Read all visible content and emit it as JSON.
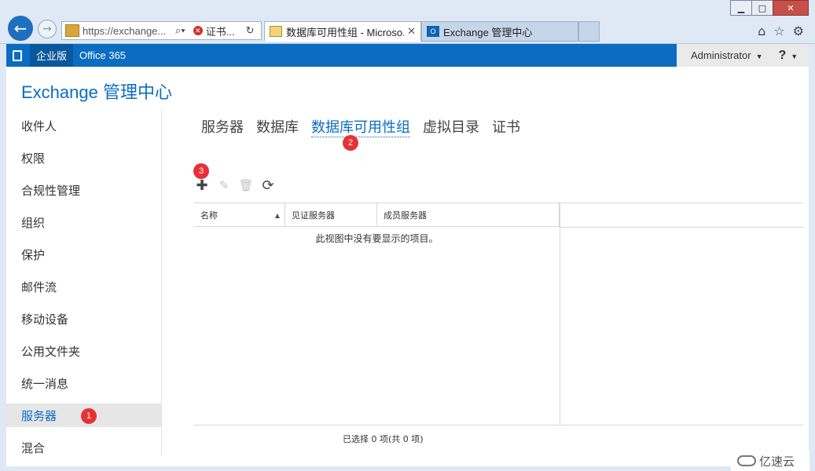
{
  "browser": {
    "address": "https://exchange...",
    "cert_label": "证书...",
    "tabs": [
      {
        "label": "数据库可用性组 - Microso...",
        "close": "✕"
      },
      {
        "label": "Exchange 管理中心"
      }
    ]
  },
  "topbar": {
    "items": [
      "企业版",
      "Office 365"
    ],
    "user": "Administrator",
    "help": "?"
  },
  "app": {
    "title": "Exchange 管理中心"
  },
  "leftnav": {
    "items": [
      "收件人",
      "权限",
      "合规性管理",
      "组织",
      "保护",
      "邮件流",
      "移动设备",
      "公用文件夹",
      "统一消息",
      "服务器",
      "混合"
    ],
    "selected_index": 9
  },
  "subnav": {
    "items": [
      "服务器",
      "数据库",
      "数据库可用性组",
      "虚拟目录",
      "证书"
    ],
    "active_index": 2
  },
  "badges": [
    "1",
    "2",
    "3"
  ],
  "toolbar": {
    "icons": [
      "add-icon",
      "edit-icon",
      "delete-icon",
      "refresh-icon"
    ]
  },
  "grid": {
    "columns": [
      "名称",
      "见证服务器",
      "成员服务器"
    ],
    "sorted_column": "名称",
    "empty_message": "此视图中没有要显示的项目。"
  },
  "status": {
    "text": "已选择 0 项(共 0 项)"
  },
  "watermark": {
    "text": "亿速云"
  },
  "colors": {
    "accent": "#0a6dc2",
    "badge": "#e63237",
    "selected_bg": "#e6e6e6"
  }
}
